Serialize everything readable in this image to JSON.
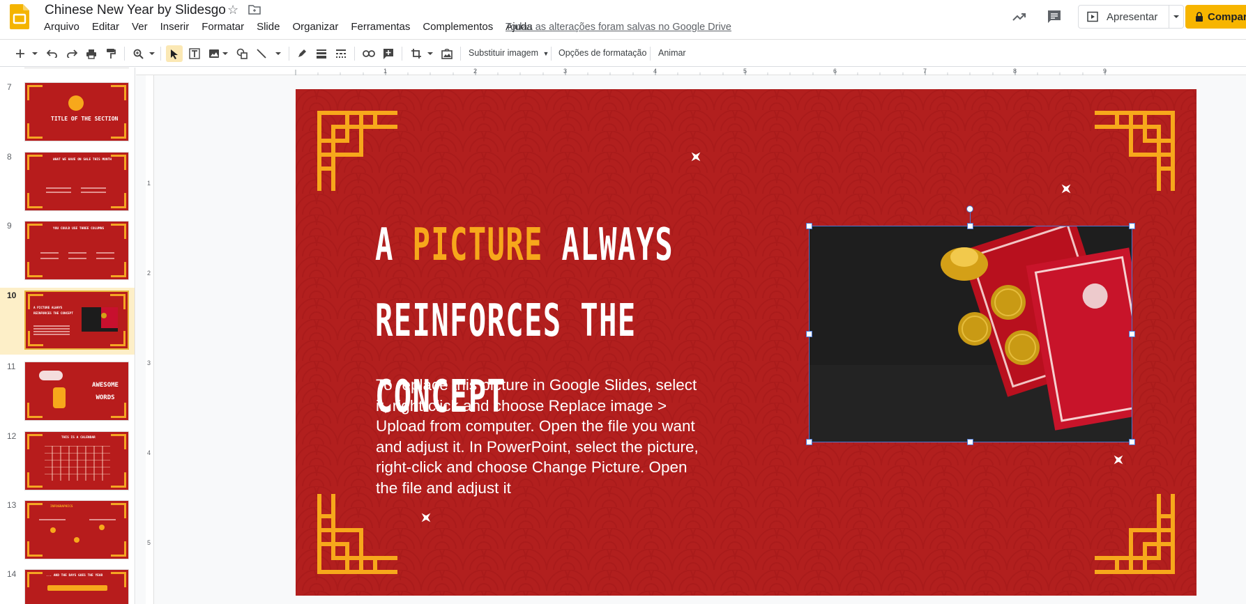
{
  "app": {
    "title": "Chinese New Year by Slidesgo",
    "saved_status": "Todas as alterações foram salvas no Google Drive"
  },
  "menu": [
    "Arquivo",
    "Editar",
    "Ver",
    "Inserir",
    "Formatar",
    "Slide",
    "Organizar",
    "Ferramentas",
    "Complementos",
    "Ajuda"
  ],
  "header": {
    "present_label": "Apresentar",
    "share_label": "Compar"
  },
  "toolbar": {
    "replace_image_label": "Substituir imagem",
    "format_options_label": "Opções de formatação",
    "animate_label": "Animar"
  },
  "ruler": {
    "top": [
      "1",
      "2",
      "3",
      "4",
      "5",
      "6",
      "7",
      "8",
      "9"
    ],
    "left": [
      "1",
      "2",
      "3",
      "4",
      "5"
    ]
  },
  "filmstrip": {
    "slides": [
      {
        "number": "7",
        "text": "TITLE OF THE SECTION"
      },
      {
        "number": "8",
        "text": "WHAT WE HAVE ON SALE THIS MONTH"
      },
      {
        "number": "9",
        "text": "YOU COULD USE THREE COLUMNS"
      },
      {
        "number": "10",
        "text": "A PICTURE ALWAYS REINFORCES THE CONCEPT"
      },
      {
        "number": "11",
        "text": "AWESOME WORDS"
      },
      {
        "number": "12",
        "text": "THIS IS A CALENDAR"
      },
      {
        "number": "13",
        "text": "INFOGRAPHICS"
      },
      {
        "number": "14",
        "text": "... AND THE DAYS GOES THE YEAR"
      }
    ],
    "active_index": 3
  },
  "slide": {
    "title_line1_a": "A ",
    "title_line1_accent": "PICTURE",
    "title_line1_b": " ALWAYS",
    "title_line2": "REINFORCES THE CONCEPT",
    "body": "To replace this picture in Google Slides, select it, right-click and choose Replace image > Upload from computer. Open the file you want and adjust it. In PowerPoint, select the picture, right-click and choose Change Picture. Open the file and adjust it"
  },
  "colors": {
    "slide_red": "#b21f1e",
    "accent_gold": "#f7a81b",
    "selection_blue": "#4a77d4",
    "share_yellow": "#f7b500",
    "active_thumb_bg": "#fdefc8"
  }
}
